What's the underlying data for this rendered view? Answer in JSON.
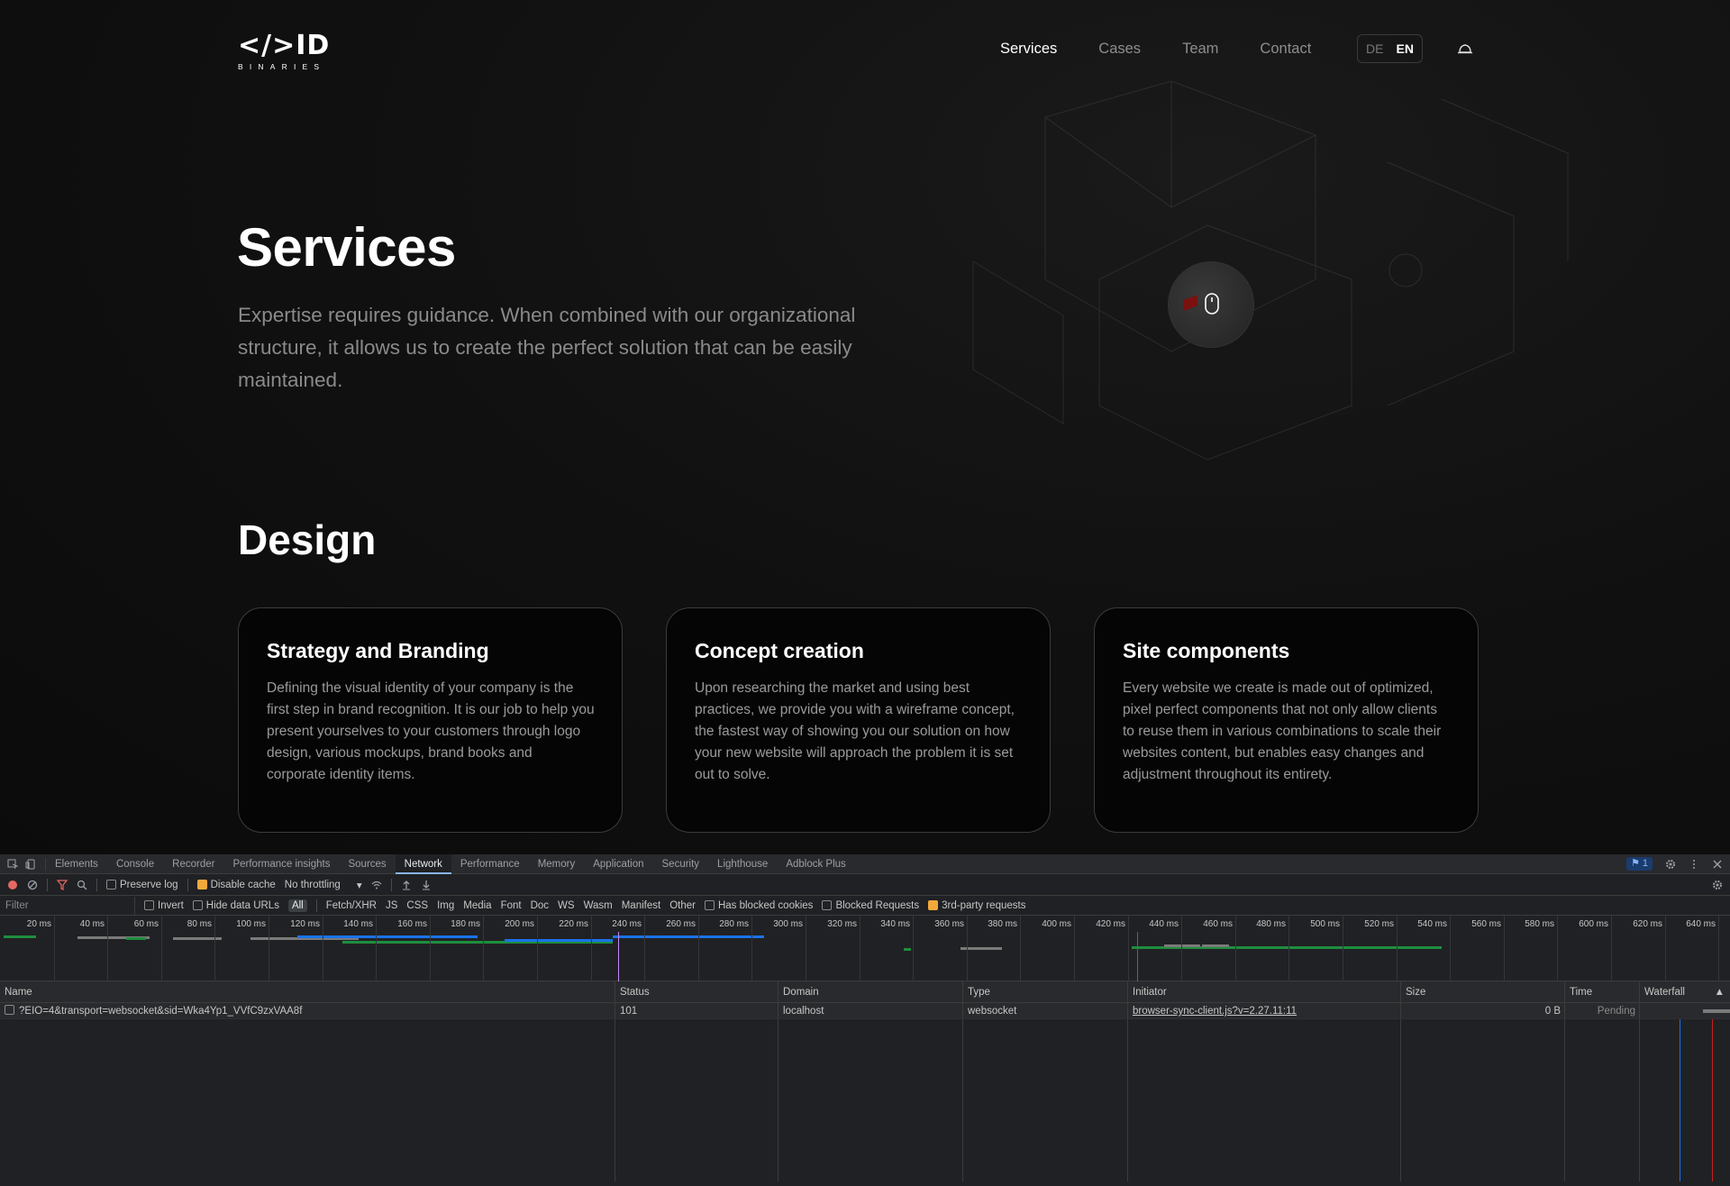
{
  "site": {
    "logo": {
      "mark": "</>ID",
      "sub": "BINARIES"
    },
    "nav": [
      {
        "label": "Services",
        "active": true
      },
      {
        "label": "Cases",
        "active": false
      },
      {
        "label": "Team",
        "active": false
      },
      {
        "label": "Contact",
        "active": false
      }
    ],
    "lang": {
      "de": "DE",
      "en": "EN"
    },
    "title": "Services",
    "lead": "Expertise requires guidance. When combined with our organizational structure, it allows us to create the perfect solution that can be easily maintained.",
    "section_title": "Design",
    "cards": [
      {
        "title": "Strategy and Branding",
        "text": "Defining the visual identity of your company is the first step in brand recognition. It is our job to help you present yourselves to your customers through logo design, various mockups, brand books and corporate identity items."
      },
      {
        "title": "Concept creation",
        "text": "Upon researching the market and using best practices, we provide you with a wireframe concept, the fastest way of showing you our solution on how your new website will approach the problem it is set out to solve."
      },
      {
        "title": "Site components",
        "text": "Every website we create is made out of optimized, pixel perfect components that not only allow clients to reuse them in various combinations to scale their websites content, but enables easy changes and adjustment throughout its entirety."
      }
    ]
  },
  "devtools": {
    "tabs": [
      "Elements",
      "Console",
      "Recorder",
      "Performance insights",
      "Sources",
      "Network",
      "Performance",
      "Memory",
      "Application",
      "Security",
      "Lighthouse",
      "Adblock Plus"
    ],
    "active_tab": "Network",
    "issues_count": "1",
    "toolbar": {
      "preserve_log": "Preserve log",
      "disable_cache": "Disable cache",
      "throttling": "No throttling"
    },
    "filter": {
      "placeholder": "Filter",
      "invert": "Invert",
      "hide_data_urls": "Hide data URLs",
      "types": [
        "All",
        "Fetch/XHR",
        "JS",
        "CSS",
        "Img",
        "Media",
        "Font",
        "Doc",
        "WS",
        "Wasm",
        "Manifest",
        "Other"
      ],
      "has_blocked_cookies": "Has blocked cookies",
      "blocked_requests": "Blocked Requests",
      "third_party": "3rd-party requests"
    },
    "overview_ticks": [
      "20 ms",
      "40 ms",
      "60 ms",
      "80 ms",
      "100 ms",
      "120 ms",
      "140 ms",
      "160 ms",
      "180 ms",
      "200 ms",
      "220 ms",
      "240 ms",
      "260 ms",
      "280 ms",
      "300 ms",
      "320 ms",
      "340 ms",
      "360 ms",
      "380 ms",
      "400 ms",
      "420 ms",
      "440 ms",
      "460 ms",
      "480 ms",
      "500 ms",
      "520 ms",
      "540 ms",
      "560 ms",
      "580 ms",
      "600 ms",
      "620 ms",
      "640 ms"
    ],
    "columns": {
      "name": "Name",
      "status": "Status",
      "domain": "Domain",
      "type": "Type",
      "initiator": "Initiator",
      "size": "Size",
      "time": "Time",
      "waterfall": "Waterfall"
    },
    "rows": [
      {
        "name": "?EIO=4&transport=websocket&sid=Wka4Yp1_VVfC9zxVAA8f",
        "status": "101",
        "domain": "localhost",
        "type": "websocket",
        "initiator": "browser-sync-client.js?v=2.27.11:11",
        "size": "0 B",
        "time": "Pending"
      }
    ],
    "colors": {
      "accent": "#8ab4f8",
      "checked": "#f2a93b"
    }
  }
}
